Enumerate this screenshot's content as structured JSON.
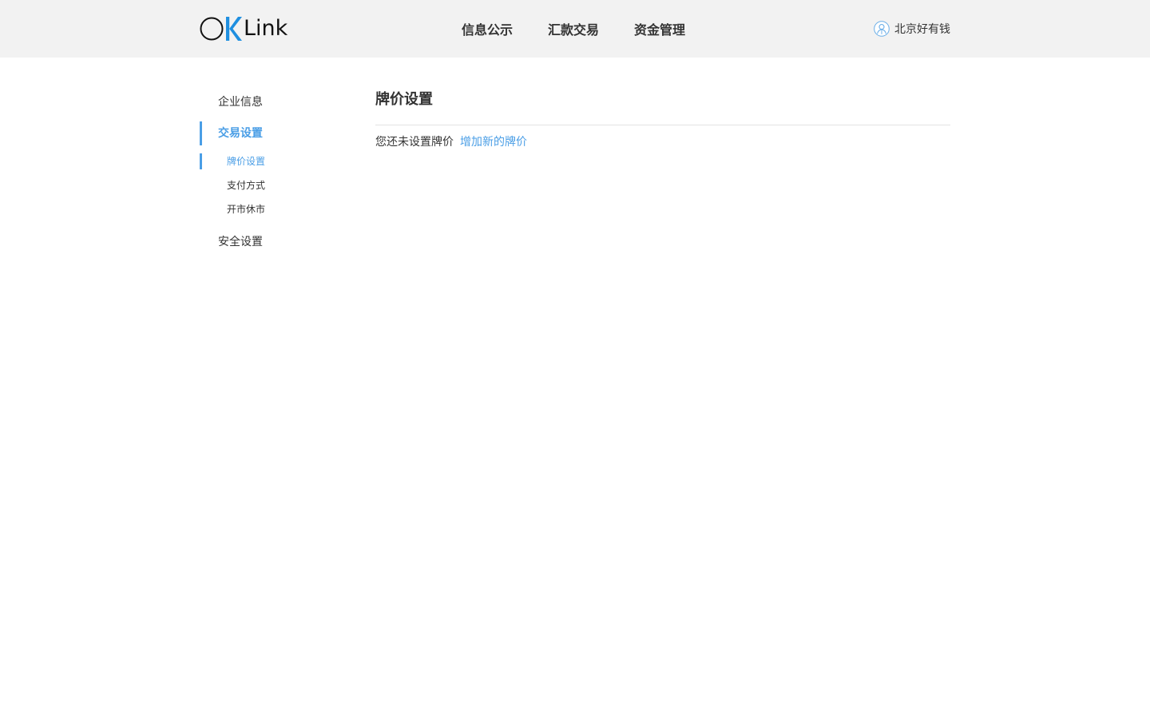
{
  "header": {
    "logo": {
      "text": "Link",
      "colors": {
        "o": "#111111",
        "k": "#1f8fe0"
      }
    },
    "nav": [
      {
        "label": "信息公示"
      },
      {
        "label": "汇款交易"
      },
      {
        "label": "资金管理"
      }
    ],
    "user": {
      "name": "北京好有钱",
      "icon": "user-avatar-icon"
    }
  },
  "sidebar": {
    "items": [
      {
        "label": "企业信息"
      },
      {
        "label": "交易设置",
        "active": true,
        "children": [
          {
            "label": "牌价设置",
            "active": true
          },
          {
            "label": "支付方式"
          },
          {
            "label": "开市休市"
          }
        ]
      },
      {
        "label": "安全设置"
      }
    ]
  },
  "main": {
    "title": "牌价设置",
    "empty_text": "您还未设置牌价",
    "add_link": "增加新的牌价"
  },
  "colors": {
    "accent": "#4a9ee6",
    "header_bg": "#f2f2f2",
    "text": "#333333",
    "divider": "#e3e3e3"
  }
}
